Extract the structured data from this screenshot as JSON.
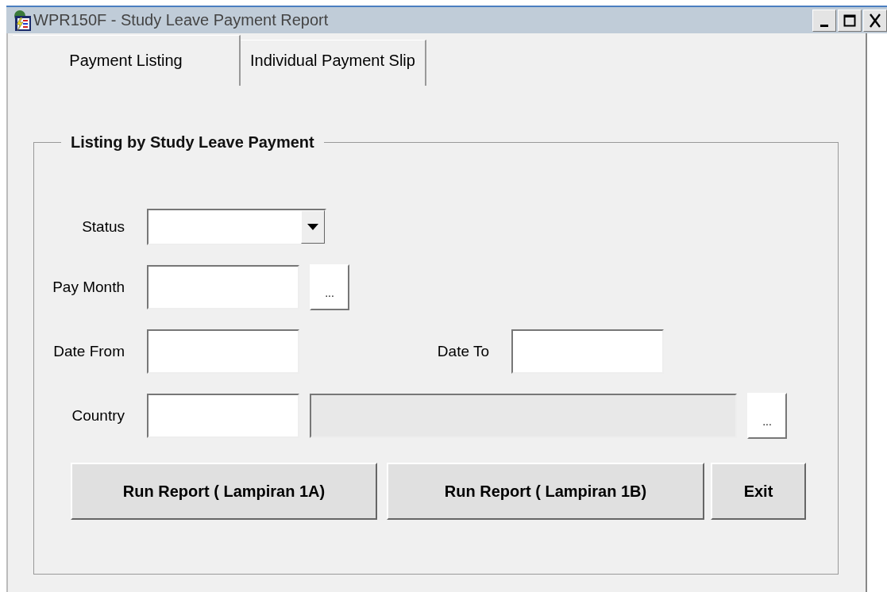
{
  "window": {
    "title": "WPR150F - Study Leave Payment Report"
  },
  "tabs": [
    {
      "label": "Payment Listing",
      "selected": true
    },
    {
      "label": "Individual Payment Slip",
      "selected": false
    }
  ],
  "group": {
    "title": "Listing by Study Leave Payment",
    "rows": [
      {
        "fields": [
          {
            "label": "Status",
            "kind": "combo"
          }
        ]
      },
      {
        "fields": [
          {
            "label": "Pay Month",
            "kind": "lookup",
            "button": "..."
          }
        ]
      },
      {
        "fields": [
          {
            "label": "Date From",
            "kind": "text"
          },
          {
            "label": "Date To",
            "kind": "text"
          }
        ]
      },
      {
        "fields": [
          {
            "label": "Country",
            "kind": "lookup_desc",
            "button": "..."
          }
        ]
      }
    ],
    "buttons": [
      {
        "label": "Run Report ( Lampiran 1A)",
        "kind": "wide"
      },
      {
        "label": "Run Report ( Lampiran 1B)",
        "kind": "wide"
      },
      {
        "label": "Exit",
        "kind": "narrow"
      }
    ]
  }
}
